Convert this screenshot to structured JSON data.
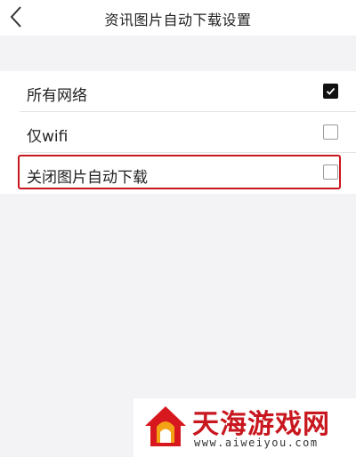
{
  "header": {
    "title": "资讯图片自动下载设置",
    "back_icon": "chevron-left-icon"
  },
  "options": [
    {
      "label": "所有网络",
      "checked": true
    },
    {
      "label": "仅wifi",
      "checked": false
    },
    {
      "label": "关闭图片自动下载",
      "checked": false,
      "highlighted": true
    }
  ],
  "colors": {
    "highlight": "#c8161d",
    "background": "#f3f3f5",
    "watermark_red": "#c8171e"
  },
  "watermark": {
    "name": "天海游戏网",
    "url": "www.aiweiyou.com"
  }
}
